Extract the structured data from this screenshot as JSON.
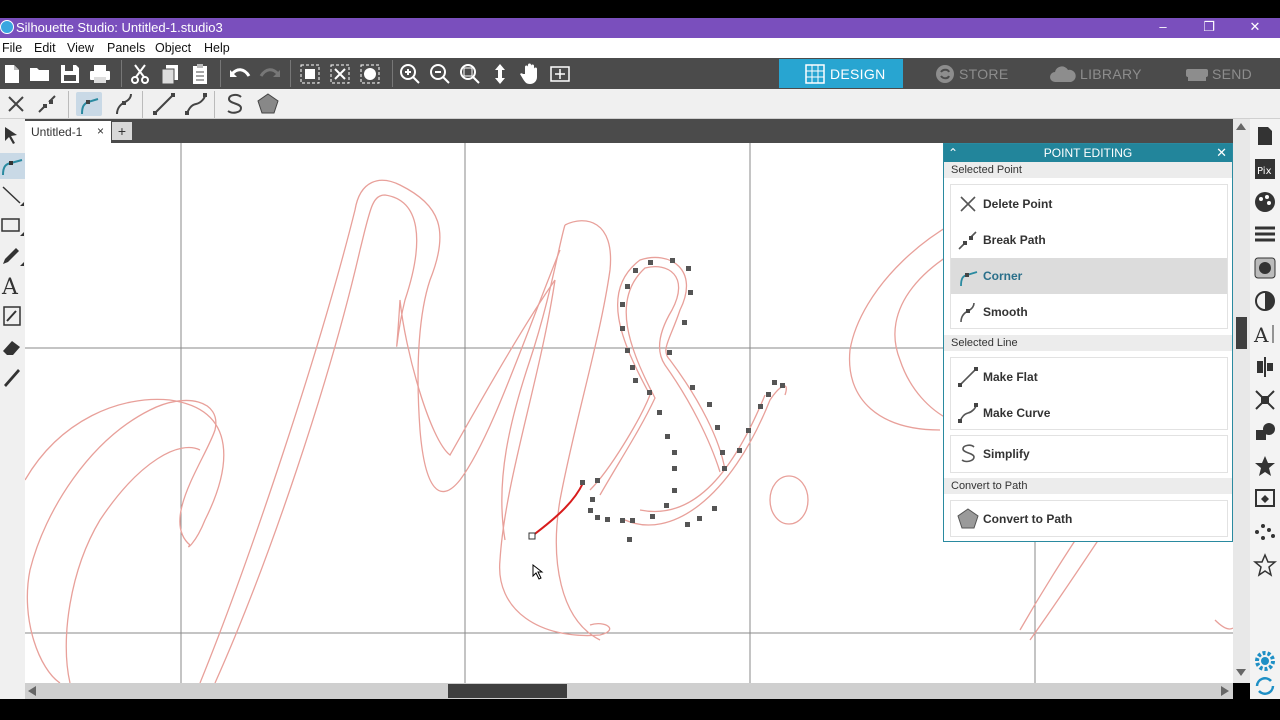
{
  "window": {
    "title": "Silhouette Studio: Untitled-1.studio3",
    "minimize": "–",
    "restore": "❐",
    "close": "✕"
  },
  "menu": [
    "File",
    "Edit",
    "View",
    "Panels",
    "Object",
    "Help"
  ],
  "nav_tabs": [
    {
      "label": "DESIGN",
      "active": true
    },
    {
      "label": "STORE",
      "active": false
    },
    {
      "label": "LIBRARY",
      "active": false
    },
    {
      "label": "SEND",
      "active": false
    }
  ],
  "document_tab": {
    "name": "Untitled-1",
    "close": "×",
    "new": "+"
  },
  "panel": {
    "title": "POINT EDITING",
    "sections": [
      {
        "label": "Selected Point",
        "items": [
          "Delete Point",
          "Break Path",
          "Corner",
          "Smooth"
        ]
      },
      {
        "label": "Selected Line",
        "items": [
          "Make Flat",
          "Make Curve"
        ]
      },
      {
        "items": [
          "Simplify"
        ]
      },
      {
        "label": "Convert to Path",
        "items": [
          "Convert to Path"
        ]
      }
    ],
    "selected_item": "Corner"
  },
  "colors": {
    "title_bar": "#7a4fbd",
    "toolbar": "#4b4b4b",
    "nav_active": "#28a5d1",
    "panel_header": "#22859b",
    "cut_line": "#e8a09a",
    "selected_segment": "#d81c1c"
  }
}
